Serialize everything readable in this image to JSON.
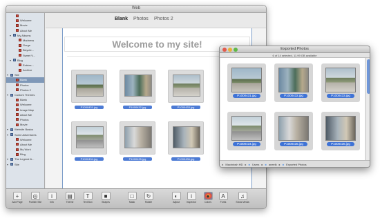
{
  "main_window": {
    "title": "Web",
    "tabs": [
      "Blank",
      "Photos",
      "Photos 2"
    ],
    "active_tab_index": 0,
    "page_heading": "Welcome to my site!",
    "sidebar": [
      {
        "label": "",
        "kind": "item",
        "indent": 2
      },
      {
        "label": "Welcome",
        "kind": "item",
        "indent": 2
      },
      {
        "label": "Movie",
        "kind": "item",
        "indent": 2
      },
      {
        "label": "About Me",
        "kind": "item",
        "indent": 2
      },
      {
        "label": "My Albums",
        "kind": "group",
        "indent": 1
      },
      {
        "label": "Madness",
        "kind": "item",
        "indent": 3
      },
      {
        "label": "Gorge",
        "kind": "item",
        "indent": 3
      },
      {
        "label": "Bicycle...",
        "kind": "item",
        "indent": 3
      },
      {
        "label": "Sweet V...",
        "kind": "item",
        "indent": 3
      },
      {
        "label": "Blog",
        "kind": "group",
        "indent": 1
      },
      {
        "label": "Entries...",
        "kind": "item",
        "indent": 3
      },
      {
        "label": "Archive",
        "kind": "item",
        "indent": 3
      },
      {
        "label": "Site",
        "kind": "group",
        "indent": 0
      },
      {
        "label": "Blank",
        "kind": "item",
        "indent": 2,
        "selected": true
      },
      {
        "label": "Photos",
        "kind": "item",
        "indent": 2
      },
      {
        "label": "Photos 2",
        "kind": "item",
        "indent": 2
      },
      {
        "label": "Custom Themes",
        "kind": "group",
        "indent": 0
      },
      {
        "label": "Blank",
        "kind": "item",
        "indent": 2
      },
      {
        "label": "Welcome",
        "kind": "item",
        "indent": 2
      },
      {
        "label": "Image Map",
        "kind": "item",
        "indent": 2
      },
      {
        "label": "About Me",
        "kind": "item",
        "indent": 2
      },
      {
        "label": "Photos",
        "kind": "item",
        "indent": 2
      },
      {
        "label": "Movie",
        "kind": "item",
        "indent": 2
      },
      {
        "label": "Website Basics",
        "kind": "group",
        "indent": 0
      },
      {
        "label": "Some Adventures",
        "kind": "group",
        "indent": 0
      },
      {
        "label": "Welcome",
        "kind": "item",
        "indent": 2
      },
      {
        "label": "About Me",
        "kind": "item",
        "indent": 2
      },
      {
        "label": "My Work",
        "kind": "item",
        "indent": 2
      },
      {
        "label": "Blog",
        "kind": "item",
        "indent": 2
      },
      {
        "label": "The Legend &...",
        "kind": "group",
        "indent": 0
      },
      {
        "label": "Site",
        "kind": "group",
        "indent": 0
      }
    ],
    "page_photos": [
      {
        "caption": "P1000431.jpg",
        "scene": "street-trees"
      },
      {
        "caption": "P1000432.jpg",
        "scene": "storefront"
      },
      {
        "caption": "P1000433.jpg",
        "scene": "sidewalk"
      },
      {
        "caption": "P1000434.jpg",
        "scene": "road"
      },
      {
        "caption": "P1000435.jpg",
        "scene": "shop"
      },
      {
        "caption": "P1000436.jpg",
        "scene": "store"
      }
    ],
    "toolbar": [
      {
        "label": "Add Page",
        "icon": "add-icon"
      },
      {
        "label": "Publish Site",
        "icon": "globe-icon"
      },
      {
        "label": "Info",
        "icon": "info-icon"
      },
      {
        "label": "Theme",
        "icon": "theme-icon"
      },
      {
        "label": "Text Box",
        "icon": "text-box-icon"
      },
      {
        "label": "Shapes",
        "icon": "shapes-icon"
      },
      {
        "label": "Mask",
        "icon": "mask-icon"
      },
      {
        "label": "Rotate",
        "icon": "rotate-icon"
      },
      {
        "label": "Adjust",
        "icon": "adjust-icon"
      },
      {
        "label": "Inspector",
        "icon": "inspector-icon"
      },
      {
        "label": "Colors",
        "icon": "colors-icon"
      },
      {
        "label": "Fonts",
        "icon": "fonts-icon"
      },
      {
        "label": "Show Media",
        "icon": "media-icon"
      }
    ]
  },
  "photos_window": {
    "title": "Exported Photos",
    "status": "6 of 14 selected, 11.99 GB available",
    "photos": [
      {
        "caption": "P1000431.jpg",
        "scene": "street-trees"
      },
      {
        "caption": "P1000432.jpg",
        "scene": "storefront"
      },
      {
        "caption": "P1000433.jpg",
        "scene": "sidewalk"
      },
      {
        "caption": "P1000434.jpg",
        "scene": "road"
      },
      {
        "caption": "P1000435.jpg",
        "scene": "shop"
      },
      {
        "caption": "P1000436.jpg",
        "scene": "store"
      }
    ],
    "path": [
      "Macintosh HD",
      "Users",
      "aneelk",
      "Exported Photos"
    ]
  },
  "colors": {
    "selection_blue": "#3f73d6",
    "sidebar_bg": "#dde3ea",
    "heading_gray": "#9c9c9c"
  }
}
